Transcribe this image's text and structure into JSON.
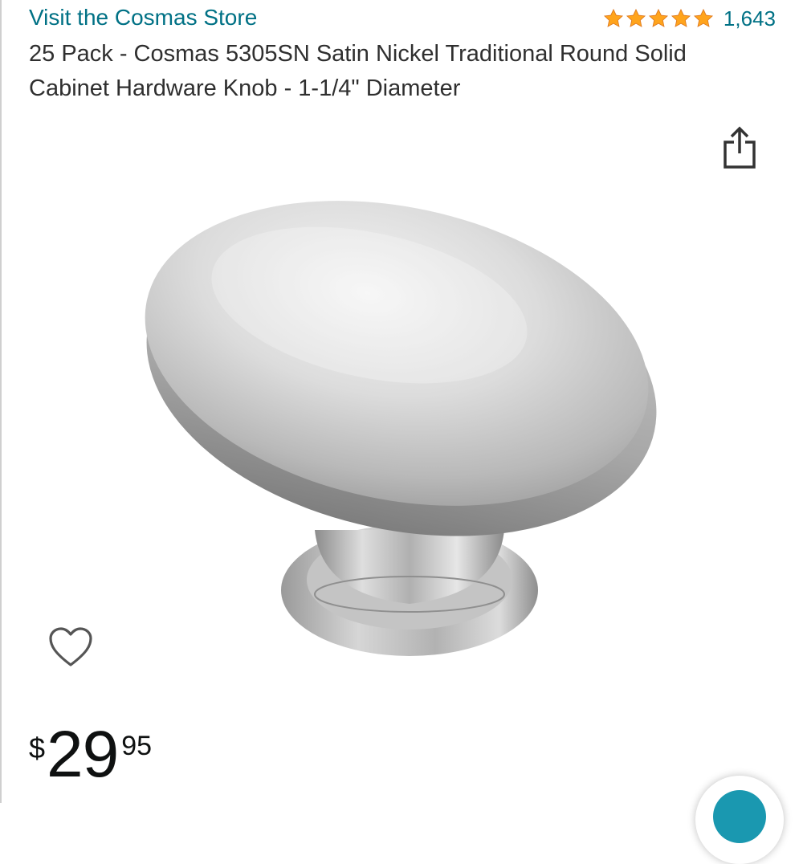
{
  "store": {
    "link_label": "Visit the Cosmas Store",
    "link_color": "#007185"
  },
  "rating": {
    "stars": 5,
    "star_color": "#ffa41c",
    "count": "1,643"
  },
  "product": {
    "title": "25 Pack - Cosmas 5305SN Satin Nickel Traditional Round Solid Cabinet Hardware Knob - 1-1/4\" Diameter",
    "image_subject": "satin-nickel-round-cabinet-knob"
  },
  "icons": {
    "share": "share-icon",
    "wishlist": "heart-icon"
  },
  "price": {
    "symbol": "$",
    "whole": "29",
    "fraction": "95"
  },
  "floating_button": {
    "color": "#1a98b0"
  }
}
